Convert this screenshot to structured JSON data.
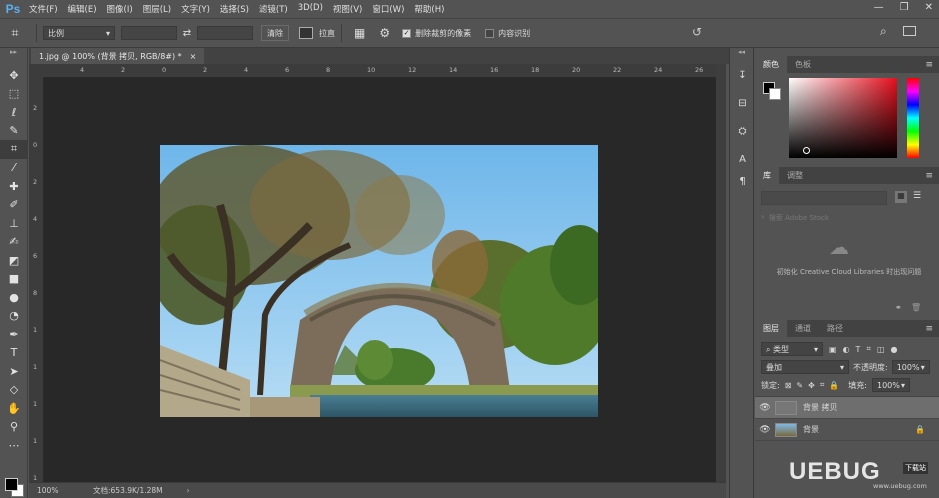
{
  "app": {
    "logo": "Ps"
  },
  "menu": [
    "文件(F)",
    "编辑(E)",
    "图像(I)",
    "图层(L)",
    "文字(Y)",
    "选择(S)",
    "滤镜(T)",
    "3D(D)",
    "视图(V)",
    "窗口(W)",
    "帮助(H)"
  ],
  "window_controls": {
    "minimize": "—",
    "restore": "❐",
    "close": "✕"
  },
  "options": {
    "ratio_select": "比例",
    "clear_label": "清除",
    "straighten_label": "拉直",
    "delete_cropped_label": "删除裁剪的像素",
    "delete_cropped_checked": true,
    "content_aware_label": "内容识别",
    "content_aware_checked": false
  },
  "document": {
    "tab_label": "1.jpg @ 100% (背景 拷贝, RGB/8#) *",
    "close": "×",
    "zoom": "100%",
    "doc_info": "文档:653.9K/1.28M",
    "ruler_ticks": [
      "4",
      "2",
      "0",
      "2",
      "4",
      "6",
      "8",
      "10",
      "12",
      "14",
      "16",
      "18",
      "20",
      "22",
      "24",
      "26"
    ],
    "vruler_ticks": [
      "2",
      "0",
      "2",
      "4",
      "6",
      "8",
      "1",
      "1",
      "1",
      "1",
      "1"
    ]
  },
  "color_panel": {
    "tabs": [
      "颜色",
      "色板"
    ]
  },
  "library_panel": {
    "tabs": [
      "库",
      "调整"
    ],
    "search_placeholder": "搜索 Adobe Stock",
    "message": "初始化 Creative Cloud Libraries 时出现问题"
  },
  "layers_panel": {
    "tabs": [
      "图层",
      "通道",
      "路径"
    ],
    "filter_label": "类型",
    "blend_mode": "叠加",
    "opacity_label": "不透明度:",
    "opacity_value": "100%",
    "lock_label": "锁定:",
    "fill_label": "填充:",
    "fill_value": "100%",
    "layers": [
      {
        "name": "背景 拷贝",
        "selected": true,
        "locked": false
      },
      {
        "name": "背景",
        "selected": false,
        "locked": true
      }
    ]
  },
  "watermark": {
    "text": "UEBUG",
    "sub": "下载站",
    "domain": "www.uebug.com"
  },
  "colors": {
    "ui_bg": "#535353",
    "canvas": "#282828",
    "accent": "#5ab0f0"
  }
}
